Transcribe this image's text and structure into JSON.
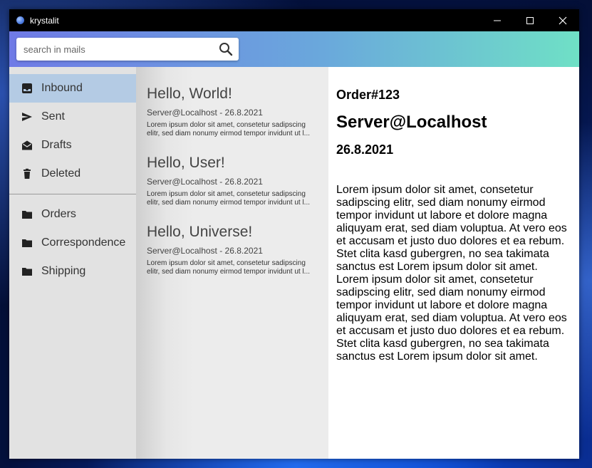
{
  "window": {
    "title": "krystalit"
  },
  "search": {
    "placeholder": "search in mails",
    "value": ""
  },
  "sidebar": {
    "items": [
      {
        "label": "Inbound",
        "icon": "inbox-icon",
        "active": true
      },
      {
        "label": "Sent",
        "icon": "send-icon"
      },
      {
        "label": "Drafts",
        "icon": "drafts-icon"
      },
      {
        "label": "Deleted",
        "icon": "trash-icon"
      }
    ],
    "folders": [
      {
        "label": "Orders",
        "icon": "folder-icon"
      },
      {
        "label": "Correspondence",
        "icon": "folder-icon"
      },
      {
        "label": "Shipping",
        "icon": "folder-icon"
      }
    ]
  },
  "mails": [
    {
      "subject": "Hello, World!",
      "meta": "Server@Localhost - 26.8.2021",
      "preview": "Lorem ipsum dolor sit amet, consetetur sadipscing elitr, sed diam nonumy eirmod tempor invidunt ut l..."
    },
    {
      "subject": "Hello, User!",
      "meta": "Server@Localhost - 26.8.2021",
      "preview": "Lorem ipsum dolor sit amet, consetetur sadipscing elitr, sed diam nonumy eirmod tempor invidunt ut l..."
    },
    {
      "subject": "Hello, Universe!",
      "meta": "Server@Localhost - 26.8.2021",
      "preview": "Lorem ipsum dolor sit amet, consetetur sadipscing elitr, sed diam nonumy eirmod tempor invidunt ut l..."
    }
  ],
  "reader": {
    "order": "Order#123",
    "sender": "Server@Localhost",
    "date": "26.8.2021",
    "body": "Lorem ipsum dolor sit amet, consetetur sadipscing elitr, sed diam nonumy eirmod tempor invidunt ut labore et dolore magna aliquyam erat, sed diam voluptua. At vero eos et accusam et justo duo dolores et ea rebum. Stet clita kasd gubergren, no sea takimata sanctus est Lorem ipsum dolor sit amet. Lorem ipsum dolor sit amet, consetetur sadipscing elitr, sed diam nonumy eirmod tempor invidunt ut labore et dolore magna aliquyam erat, sed diam voluptua. At vero eos et accusam et justo duo dolores et ea rebum. Stet clita kasd gubergren, no sea takimata sanctus est Lorem ipsum dolor sit amet."
  },
  "colors": {
    "header_gradient_start": "#6f7ae6",
    "header_gradient_end": "#6fe0c6",
    "sidebar_active": "#b4cbe4",
    "sidebar_bg": "#e2e2e2"
  }
}
